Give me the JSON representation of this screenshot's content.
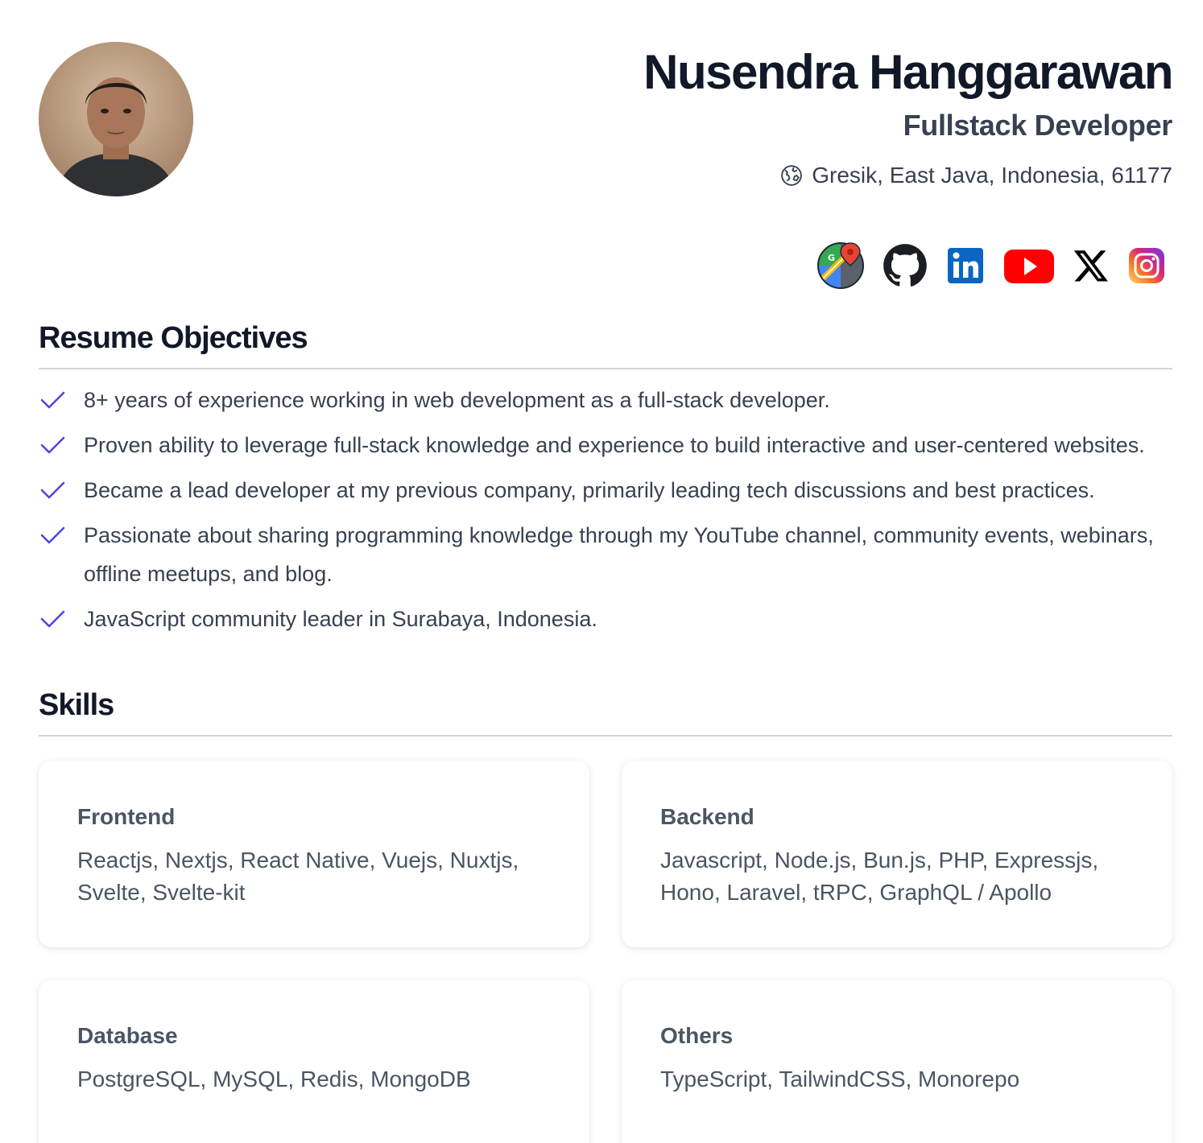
{
  "profile": {
    "name": "Nusendra Hanggarawan",
    "role": "Fullstack Developer",
    "location": "Gresik, East Java, Indonesia, 61177"
  },
  "socials": [
    {
      "name": "google-maps-icon"
    },
    {
      "name": "github-icon"
    },
    {
      "name": "linkedin-icon"
    },
    {
      "name": "youtube-icon"
    },
    {
      "name": "x-icon"
    },
    {
      "name": "instagram-icon"
    }
  ],
  "objectives": {
    "title": "Resume Objectives",
    "items": [
      "8+ years of experience working in web development as a full-stack developer.",
      "Proven ability to leverage full-stack knowledge and experience to build interactive and user-centered websites.",
      "Became a lead developer at my previous company, primarily leading tech discussions and best practices.",
      "Passionate about sharing programming knowledge through my YouTube channel, community events, webinars, offline meetups, and blog.",
      "JavaScript community leader in Surabaya, Indonesia."
    ]
  },
  "skills": {
    "title": "Skills",
    "cards": [
      {
        "title": "Frontend",
        "body": "Reactjs, Nextjs, React Native, Vuejs, Nuxtjs, Svelte, Svelte-kit"
      },
      {
        "title": "Backend",
        "body": "Javascript, Node.js, Bun.js, PHP, Expressjs, Hono, Laravel, tRPC, GraphQL / Apollo"
      },
      {
        "title": "Database",
        "body": "PostgreSQL, MySQL, Redis, MongoDB"
      },
      {
        "title": "Others",
        "body": "TypeScript, TailwindCSS, Monorepo"
      }
    ]
  },
  "colors": {
    "check": "#4f46e5",
    "text": "#374151",
    "heading": "#111827"
  }
}
